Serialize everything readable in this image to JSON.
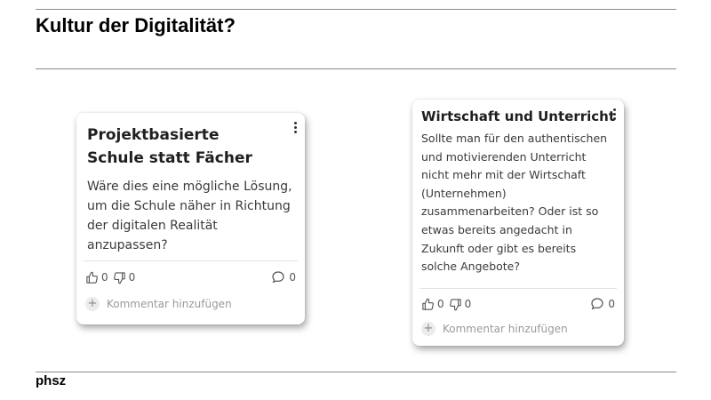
{
  "header": {
    "title": "Kultur der Digitalität?"
  },
  "footer": {
    "brand": "phsz"
  },
  "cards": [
    {
      "title": "Projektbasierte Schule statt Fächer",
      "body": "Wäre dies eine mögliche Lösung, um die Schule näher in Richtung der digitalen Realität anzupassen?",
      "likes": "0",
      "dislikes": "0",
      "comments": "0",
      "add_comment_placeholder": "Kommentar hinzufügen"
    },
    {
      "title": "Wirtschaft und Unterricht",
      "body": "Sollte man für den authentischen und motivierenden Unterricht nicht mehr mit der Wirtschaft (Unternehmen) zusammenarbeiten? Oder ist so etwas bereits angedacht in Zukunft oder gibt es bereits solche Angebote?",
      "likes": "0",
      "dislikes": "0",
      "comments": "0",
      "add_comment_placeholder": "Kommentar hinzufügen"
    }
  ]
}
